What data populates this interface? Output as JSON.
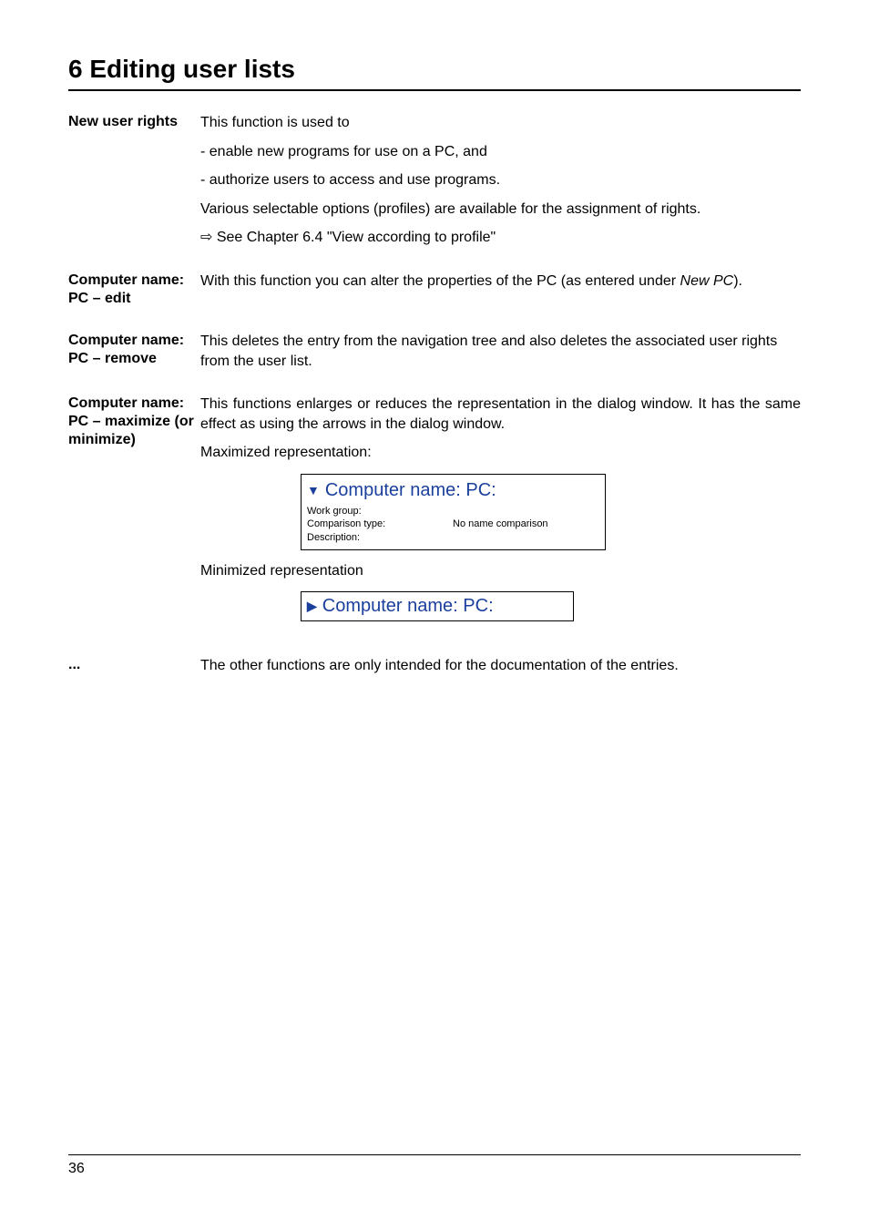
{
  "chapterTitle": "6 Editing user lists",
  "sections": [
    {
      "label": "New user rights",
      "paragraphs": [
        "This function is used to",
        "- enable new programs for use on a PC, and",
        "- authorize users to access and use programs.",
        "Various selectable options (profiles) are available for the assignment of rights.",
        "⇨  See Chapter 6.4 \"View according to profile\""
      ]
    },
    {
      "label": "Computer name: PC – edit",
      "contentPrefix": "With this function you can alter the properties of the PC (as entered under ",
      "contentItalic": "New PC",
      "contentSuffix": ")."
    },
    {
      "label": "Computer name: PC – remove",
      "text": "This deletes the entry from the navigation tree and also deletes the associated user rights from the user list."
    },
    {
      "label": "Computer name: PC – maximize (or minimize)",
      "para1": "This functions enlarges or reduces the representation in the dialog window. It has the same effect as using the arrows in the dialog window.",
      "para2": "Maximized representation:",
      "maxFig": {
        "arrow": "▼",
        "title": "Computer name: PC:",
        "workGroupLabel": "Work group:",
        "compTypeLabel": "Comparison type:",
        "compTypeValue": "No name comparison",
        "descLabel": "Description:"
      },
      "para3": "Minimized representation",
      "minFig": {
        "arrow": "▶",
        "title": "Computer name: PC:"
      }
    },
    {
      "label": "...",
      "text": "The other functions are only intended for the documentation of the entries."
    }
  ],
  "pageNumber": "36"
}
